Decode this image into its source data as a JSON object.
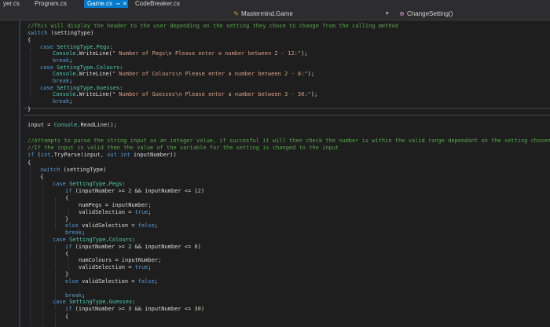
{
  "tabs": [
    {
      "label": "yer.cs",
      "active": false
    },
    {
      "label": "Program.cs",
      "active": false
    },
    {
      "label": "Game.cs",
      "active": true
    },
    {
      "label": "CodeBreaker.cs",
      "active": false
    }
  ],
  "tab_glyphs": {
    "pin": "⊸",
    "close": "✕"
  },
  "navigation": {
    "type_dropdown": "Mastermind.Game",
    "member_dropdown": "ChangeSetting()",
    "type_icon": "class-icon",
    "member_icon": "method-icon"
  },
  "colors": {
    "keyword": "#569cd6",
    "type": "#4ec9b0",
    "string": "#d69d85",
    "comment": "#57a64a",
    "number": "#b5cea8",
    "text": "#dcdcdc",
    "accent_tab": "#007acc",
    "background": "#1e1e1e"
  },
  "code_lines": [
    [
      [
        "cm",
        "//This will display the header to the user depending on the setting they chose to change from the calling method"
      ]
    ],
    [
      [
        "kw",
        "switch"
      ],
      [
        "t",
        " (settingType)"
      ]
    ],
    [
      [
        "t",
        "{"
      ]
    ],
    [
      [
        "kw",
        "case"
      ],
      [
        "t",
        " "
      ],
      [
        "ty",
        "SettingType"
      ],
      [
        "t",
        "."
      ],
      [
        "ty",
        "Pegs"
      ],
      [
        "t",
        ":"
      ]
    ],
    [
      [
        "ty",
        "Console"
      ],
      [
        "t",
        ".WriteLine("
      ],
      [
        "str",
        "\" Number of Pegs\\n Please enter a number between 2 - 12:\""
      ],
      [
        "t",
        ");"
      ]
    ],
    [
      [
        "kw",
        "break"
      ],
      [
        "t",
        ";"
      ]
    ],
    [
      [
        "kw",
        "case"
      ],
      [
        "t",
        " "
      ],
      [
        "ty",
        "SettingType"
      ],
      [
        "t",
        "."
      ],
      [
        "ty",
        "Colours"
      ],
      [
        "t",
        ":"
      ]
    ],
    [
      [
        "ty",
        "Console"
      ],
      [
        "t",
        ".WriteLine("
      ],
      [
        "str",
        "\" Number of Colours\\n Please enter a number between 2 - 8:\""
      ],
      [
        "t",
        ");"
      ]
    ],
    [
      [
        "kw",
        "break"
      ],
      [
        "t",
        ";"
      ]
    ],
    [
      [
        "kw",
        "case"
      ],
      [
        "t",
        " "
      ],
      [
        "ty",
        "SettingType"
      ],
      [
        "t",
        "."
      ],
      [
        "ty",
        "Guesses"
      ],
      [
        "t",
        ":"
      ]
    ],
    [
      [
        "ty",
        "Console"
      ],
      [
        "t",
        ".WriteLine("
      ],
      [
        "str",
        "\" Number of Guesses\\n Please enter a number between 3 - 30:\""
      ],
      [
        "t",
        ");"
      ]
    ],
    [
      [
        "kw",
        "break"
      ],
      [
        "t",
        ";"
      ]
    ],
    [
      [
        "t",
        "}"
      ]
    ],
    [],
    [
      [
        "t",
        "input = "
      ],
      [
        "ty",
        "Console"
      ],
      [
        "t",
        ".ReadLine();"
      ]
    ],
    [],
    [
      [
        "cm",
        "//Attempts to parse the string input as an integer value, if succesful it will then check the number is within the valid range dependant on the setting chosen"
      ]
    ],
    [
      [
        "cm",
        "//If the input is valid then the value of the variable for the setting is changed to the input"
      ]
    ],
    [
      [
        "kw",
        "if"
      ],
      [
        "t",
        " ("
      ],
      [
        "kw",
        "int"
      ],
      [
        "t",
        ".TryParse(input, "
      ],
      [
        "kw",
        "out"
      ],
      [
        "t",
        " "
      ],
      [
        "kw",
        "int"
      ],
      [
        "t",
        " inputNumber))"
      ]
    ],
    [
      [
        "t",
        "{"
      ]
    ],
    [
      [
        "kw",
        "switch"
      ],
      [
        "t",
        " (settingType)"
      ]
    ],
    [
      [
        "t",
        "{"
      ]
    ],
    [
      [
        "kw",
        "case"
      ],
      [
        "t",
        " "
      ],
      [
        "ty",
        "SettingType"
      ],
      [
        "t",
        "."
      ],
      [
        "ty",
        "Pegs"
      ],
      [
        "t",
        ":"
      ]
    ],
    [
      [
        "kw",
        "if"
      ],
      [
        "t",
        " (inputNumber >= "
      ],
      [
        "num",
        "2"
      ],
      [
        "t",
        " && inputNumber <= "
      ],
      [
        "num",
        "12"
      ],
      [
        "t",
        ")"
      ]
    ],
    [
      [
        "t",
        "{"
      ]
    ],
    [
      [
        "t",
        "numPegs = inputNumber;"
      ]
    ],
    [
      [
        "t",
        "validSelection = "
      ],
      [
        "kw",
        "true"
      ],
      [
        "t",
        ";"
      ]
    ],
    [
      [
        "t",
        "}"
      ]
    ],
    [
      [
        "kw",
        "else"
      ],
      [
        "t",
        " validSelection = "
      ],
      [
        "kw",
        "false"
      ],
      [
        "t",
        ";"
      ]
    ],
    [
      [
        "kw",
        "break"
      ],
      [
        "t",
        ";"
      ]
    ],
    [
      [
        "kw",
        "case"
      ],
      [
        "t",
        " "
      ],
      [
        "ty",
        "SettingType"
      ],
      [
        "t",
        "."
      ],
      [
        "ty",
        "Colours"
      ],
      [
        "t",
        ":"
      ]
    ],
    [
      [
        "kw",
        "if"
      ],
      [
        "t",
        " (inputNumber >= "
      ],
      [
        "num",
        "2"
      ],
      [
        "t",
        " && inputNumber <= "
      ],
      [
        "num",
        "8"
      ],
      [
        "t",
        ")"
      ]
    ],
    [
      [
        "t",
        "{"
      ]
    ],
    [
      [
        "t",
        "numColours = inputNumber;"
      ]
    ],
    [
      [
        "t",
        "validSelection = "
      ],
      [
        "kw",
        "true"
      ],
      [
        "t",
        ";"
      ]
    ],
    [
      [
        "t",
        "}"
      ]
    ],
    [
      [
        "kw",
        "else"
      ],
      [
        "t",
        " validSelection = "
      ],
      [
        "kw",
        "false"
      ],
      [
        "t",
        ";"
      ]
    ],
    [],
    [
      [
        "kw",
        "break"
      ],
      [
        "t",
        ";"
      ]
    ],
    [
      [
        "kw",
        "case"
      ],
      [
        "t",
        " "
      ],
      [
        "ty",
        "SettingType"
      ],
      [
        "t",
        "."
      ],
      [
        "ty",
        "Guesses"
      ],
      [
        "t",
        ":"
      ]
    ],
    [
      [
        "kw",
        "if"
      ],
      [
        "t",
        " (inputNumber >= "
      ],
      [
        "num",
        "3"
      ],
      [
        "t",
        " && inputNumber <= "
      ],
      [
        "num",
        "30"
      ],
      [
        "t",
        ")"
      ]
    ],
    [
      [
        "t",
        "{"
      ]
    ]
  ]
}
